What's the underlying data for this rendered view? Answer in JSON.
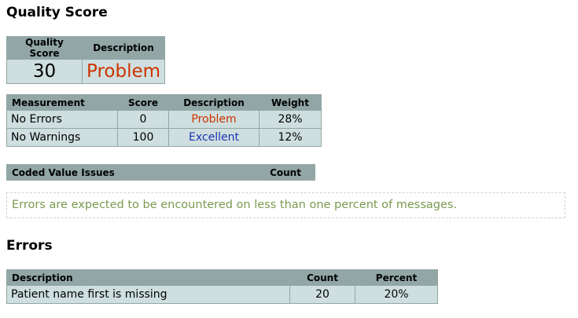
{
  "quality_section": {
    "heading": "Quality Score",
    "summary": {
      "headers": [
        "Quality Score",
        "Description"
      ],
      "score": "30",
      "description": "Problem"
    },
    "measurements": {
      "headers": [
        "Measurement",
        "Score",
        "Description",
        "Weight"
      ],
      "rows": [
        {
          "measurement": "No Errors",
          "score": "0",
          "description": "Problem",
          "weight": "28%"
        },
        {
          "measurement": "No Warnings",
          "score": "100",
          "description": "Excellent",
          "weight": "12%"
        }
      ]
    },
    "coded_issues": {
      "headers": [
        "Coded Value Issues",
        "Count"
      ]
    },
    "note": "Errors are expected to be encountered on less than one percent of messages."
  },
  "errors_section": {
    "heading": "Errors",
    "headers": [
      "Description",
      "Count",
      "Percent"
    ],
    "rows": [
      {
        "description": "Patient name first is missing",
        "count": "20",
        "percent": "20%"
      }
    ]
  },
  "colors": {
    "header_bg": "#92a6a6",
    "cell_bg": "#cfdfdf",
    "problem": "#cc3300",
    "excellent": "#1a33b3",
    "note_text": "#7a9a50"
  }
}
